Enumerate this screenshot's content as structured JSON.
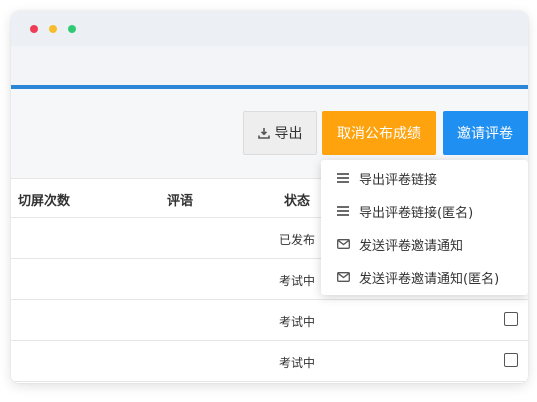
{
  "toolbar": {
    "export_label": "导出",
    "cancel_publish_label": "取消公布成绩",
    "invite_review_label": "邀请评卷"
  },
  "table": {
    "headers": [
      "切屏次数",
      "评语",
      "状态"
    ],
    "rows": [
      {
        "status": "已发布",
        "checkbox_visible": false
      },
      {
        "status": "考试中",
        "checkbox_visible": false
      },
      {
        "status": "考试中",
        "checkbox_visible": true
      },
      {
        "status": "考试中",
        "checkbox_visible": true
      }
    ]
  },
  "dropdown": {
    "items": [
      {
        "label": "导出评卷链接",
        "icon": "list-icon"
      },
      {
        "label": "导出评卷链接(匿名)",
        "icon": "list-icon"
      },
      {
        "label": "发送评卷邀请通知",
        "icon": "envelope-icon"
      },
      {
        "label": "发送评卷邀请通知(匿名)",
        "icon": "envelope-icon"
      }
    ]
  },
  "colors": {
    "accent_blue": "#1f8ff2",
    "accent_orange": "#fea20e",
    "nav_line": "#2c86d8"
  }
}
